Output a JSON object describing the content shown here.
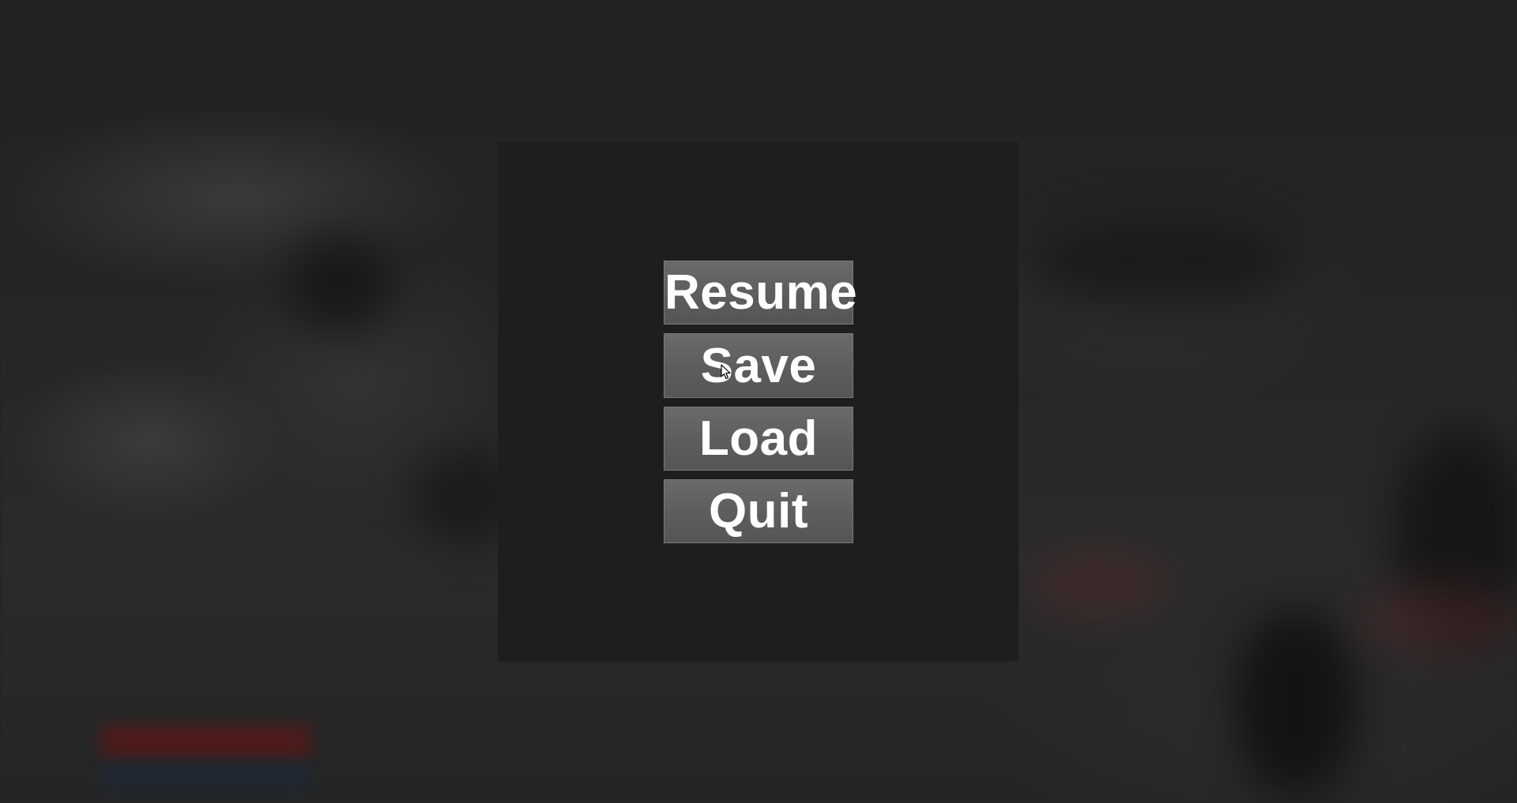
{
  "pause_menu": {
    "buttons": [
      {
        "label": "Resume"
      },
      {
        "label": "Save"
      },
      {
        "label": "Load"
      },
      {
        "label": "Quit"
      }
    ]
  },
  "colors": {
    "panel": "#1e1e1e",
    "button_fill": "#5e5e5e",
    "button_text": "#ffffff",
    "backdrop": "#232323"
  },
  "icons": {
    "cursor": "mouse-cursor-icon"
  }
}
